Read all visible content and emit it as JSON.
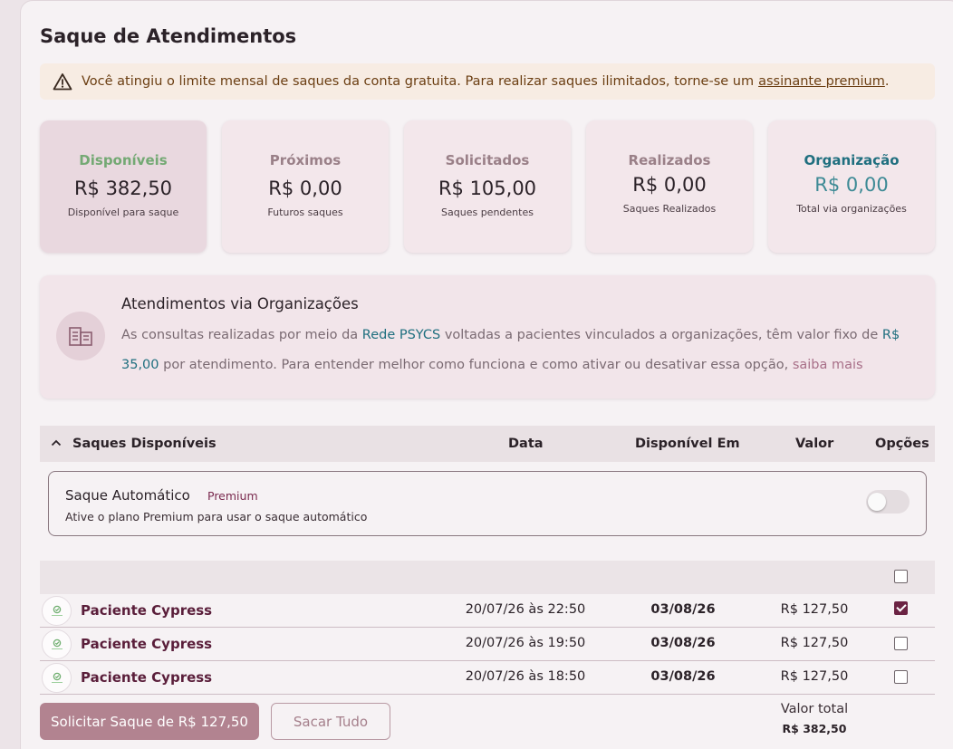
{
  "page": {
    "title": "Saque de Atendimentos"
  },
  "alert": {
    "text": "Você atingiu o limite mensal de saques da conta gratuita. Para realizar saques ilimitados, torne-se um",
    "link": "assinante premium",
    "suffix": "."
  },
  "cards": [
    {
      "label": "Disponíveis",
      "value": "R$ 382,50",
      "sub": "Disponível para saque"
    },
    {
      "label": "Próximos",
      "value": "R$ 0,00",
      "sub": "Futuros saques"
    },
    {
      "label": "Solicitados",
      "value": "R$ 105,00",
      "sub": "Saques pendentes"
    },
    {
      "label": "Realizados",
      "value": "R$ 0,00",
      "sub": "Saques Realizados"
    },
    {
      "label": "Organização",
      "value": "R$ 0,00",
      "sub": "Total via organizações"
    }
  ],
  "org": {
    "heading": "Atendimentos via Organizações",
    "p1": "As consultas realizadas por meio da",
    "network": "Rede PSYCS",
    "p2": "voltadas a pacientes vinculados a organizações, têm valor fixo de",
    "price": "R$ 35,00",
    "p3": "por atendimento. Para entender melhor como funciona e como ativar ou desativar essa opção,",
    "link": "saiba mais"
  },
  "table": {
    "section": "Saques Disponíveis",
    "col_date": "Data",
    "col_available": "Disponível Em",
    "col_value": "Valor",
    "col_options": "Opções"
  },
  "auto": {
    "title": "Saque Automático",
    "badge": "Premium",
    "desc": "Ative o plano Premium para usar o saque automático"
  },
  "rows": [
    {
      "name": "Paciente Cypress",
      "date": "20/07/26 às 22:50",
      "available": "03/08/26",
      "value": "R$ 127,50",
      "checked": true
    },
    {
      "name": "Paciente Cypress",
      "date": "20/07/26 às 19:50",
      "available": "03/08/26",
      "value": "R$ 127,50",
      "checked": false
    },
    {
      "name": "Paciente Cypress",
      "date": "20/07/26 às 18:50",
      "available": "03/08/26",
      "value": "R$ 127,50",
      "checked": false
    }
  ],
  "actions": {
    "request": "Solicitar Saque de R$ 127,50",
    "withdraw_all": "Sacar Tudo",
    "total_label": "Valor total",
    "total_value": "R$ 382,50"
  },
  "icons": {
    "alert": "warning-triangle-icon",
    "org": "building-icon",
    "collapse": "chevron-up-icon",
    "avatar": "patient-avatar-icon"
  },
  "colors": {
    "accent": "#6b2343",
    "teal": "#1f6f7f",
    "green": "#74a974",
    "button": "#b28390"
  }
}
